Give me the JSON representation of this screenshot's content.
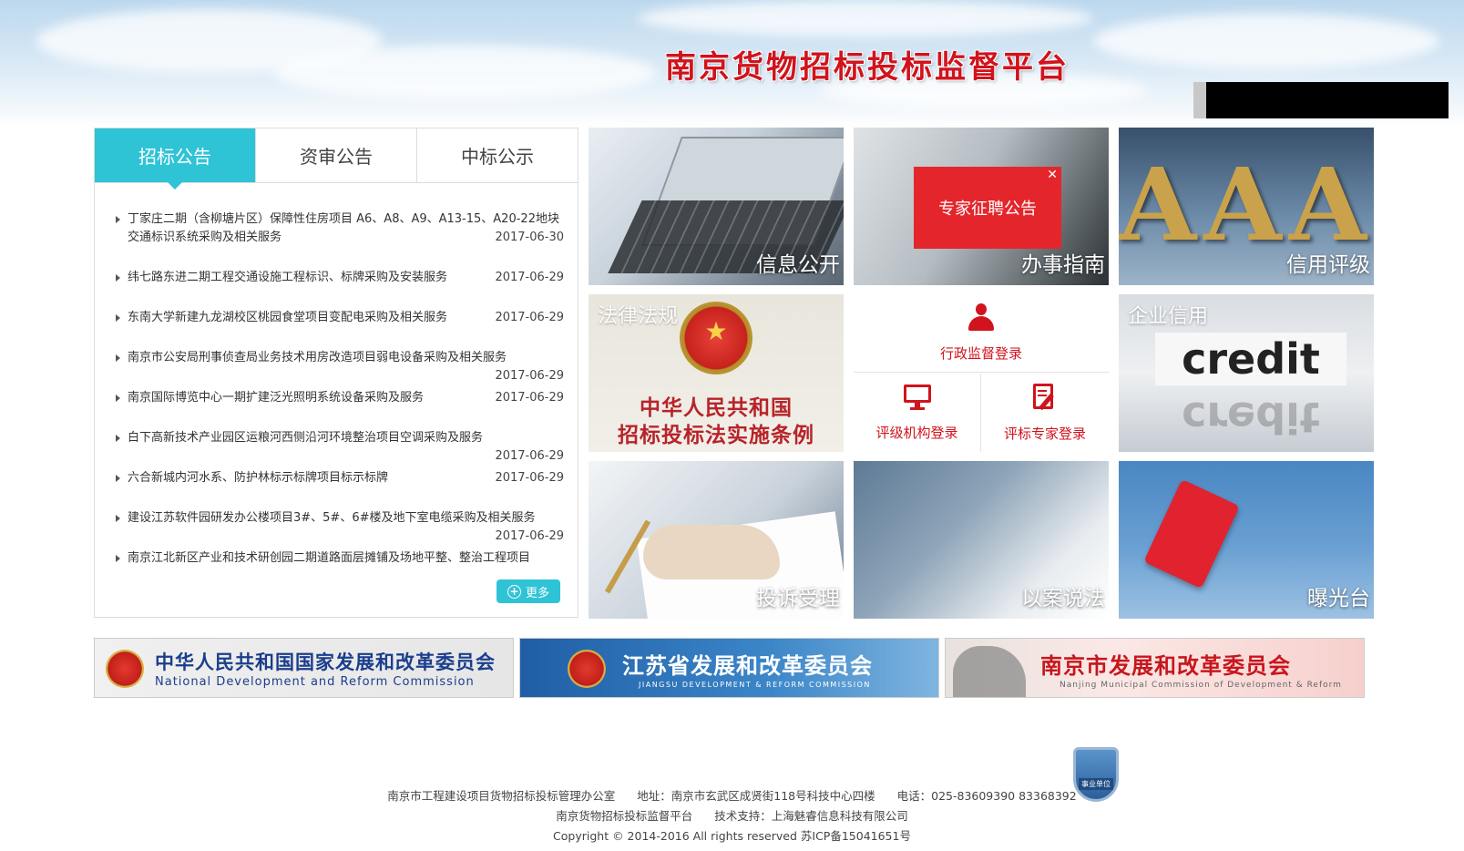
{
  "header": {
    "site_title": "南京货物招标投标监督平台"
  },
  "news": {
    "tabs": [
      "招标公告",
      "资审公告",
      "中标公示"
    ],
    "active_tab": 0,
    "items": [
      {
        "title": "丁家庄二期（含柳塘片区）保障性住房项目 A6、A8、A9、A13-15、A20-22地块交通标识系统采购及相关服务",
        "date": "2017-06-30"
      },
      {
        "title": "纬七路东进二期工程交通设施工程标识、标牌采购及安装服务",
        "date": "2017-06-29"
      },
      {
        "title": "东南大学新建九龙湖校区桃园食堂项目变配电采购及相关服务",
        "date": "2017-06-29"
      },
      {
        "title": "南京市公安局刑事侦查局业务技术用房改造项目弱电设备采购及相关服务",
        "date": "2017-06-29"
      },
      {
        "title": "南京国际博览中心一期扩建泛光照明系统设备采购及服务",
        "date": "2017-06-29"
      },
      {
        "title": "白下高新技术产业园区运粮河西侧沿河环境整治项目空调采购及服务",
        "date": "2017-06-29"
      },
      {
        "title": "六合新城内河水系、防护林标示标牌项目标示标牌",
        "date": "2017-06-29"
      },
      {
        "title": "建设江苏软件园研发办公楼项目3#、5#、6#楼及地下室电缆采购及相关服务",
        "date": "2017-06-29"
      },
      {
        "title": "南京江北新区产业和技术研创园二期道路面层摊铺及场地平整、整治工程项目",
        "date": ""
      }
    ],
    "more_label": "更多"
  },
  "tiles": {
    "info": "信息公开",
    "guide": "办事指南",
    "credit_rating": "信用评级",
    "law": "法律法规",
    "law_title_line1": "中华人民共和国",
    "law_title_line2": "招标投标法实施条例",
    "enterprise_credit": "企业信用",
    "credit_word": "credit",
    "complaint": "投诉受理",
    "case": "以案说法",
    "expose": "曝光台",
    "aaa": "AAA"
  },
  "popup": {
    "label": "专家征聘公告",
    "close": "✕"
  },
  "login": {
    "admin": "行政监督登录",
    "rating_org": "评级机构登录",
    "expert": "评标专家登录"
  },
  "banners": {
    "ndrc_main": "中华人民共和国国家发展和改革委员会",
    "ndrc_sub": "National Development and Reform Commission",
    "js_main": "江苏省发展和改革委员会",
    "js_sub": "JIANGSU DEVELOPMENT & REFORM COMMISSION",
    "nj_main": "南京市发展和改革委员会",
    "nj_sub": "Nanjing Municipal Commission of Development & Reform"
  },
  "footer": {
    "office": "南京市工程建设项目货物招标投标管理办公室",
    "address": "地址：南京市玄武区成贤街118号科技中心四楼",
    "phone": "电话：025-83609390 83368392",
    "platform": "南京货物招标投标监督平台",
    "support": "技术支持：上海魅睿信息科技有限公司",
    "copyright": "Copyright © 2014-2016 All rights reserved 苏ICP备15041651号",
    "badge": "事业单位"
  }
}
